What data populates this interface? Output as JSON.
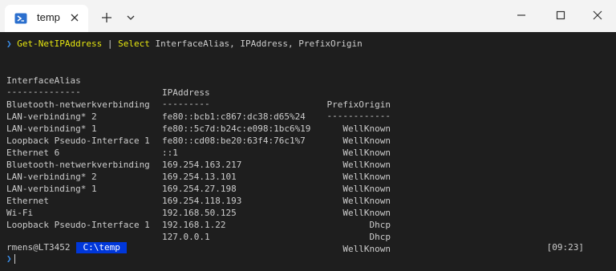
{
  "tab": {
    "title": "temp",
    "icon": "powershell-icon"
  },
  "window_controls": {
    "minimize": "minimize-icon",
    "maximize": "maximize-icon",
    "close": "close-icon"
  },
  "command": {
    "prompt_symbol": "❯",
    "cmdlet": "Get-NetIPAddress",
    "pipe": "|",
    "select": "Select",
    "args": "InterfaceAlias, IPAddress, PrefixOrigin"
  },
  "table": {
    "headers": [
      "InterfaceAlias",
      "IPAddress",
      "PrefixOrigin"
    ],
    "underlines": [
      "--------------",
      "---------",
      "------------"
    ],
    "rows": [
      [
        "Bluetooth-netwerkverbinding",
        "fe80::bcb1:c867:dc38:d65%24",
        "WellKnown"
      ],
      [
        "LAN-verbinding* 2",
        "fe80::5c7d:b24c:e098:1bc6%19",
        "WellKnown"
      ],
      [
        "LAN-verbinding* 1",
        "fe80::cd08:be20:63f4:76c1%7",
        "WellKnown"
      ],
      [
        "Loopback Pseudo-Interface 1",
        "::1",
        "WellKnown"
      ],
      [
        "Ethernet 6",
        "169.254.163.217",
        "WellKnown"
      ],
      [
        "Bluetooth-netwerkverbinding",
        "169.254.13.101",
        "WellKnown"
      ],
      [
        "LAN-verbinding* 2",
        "169.254.27.198",
        "WellKnown"
      ],
      [
        "LAN-verbinding* 1",
        "169.254.118.193",
        "WellKnown"
      ],
      [
        "Ethernet",
        "192.168.50.125",
        "Dhcp"
      ],
      [
        "Wi-Fi",
        "192.168.1.22",
        "Dhcp"
      ],
      [
        "Loopback Pseudo-Interface 1",
        "127.0.0.1",
        "WellKnown"
      ]
    ]
  },
  "status": {
    "user": "rmens@LT3452",
    "path": "C:\\temp",
    "time": "[09:23]"
  },
  "colors": {
    "background": "#1e1e1e",
    "accent": "#0037da",
    "command": "#e5e510",
    "prompt": "#3b8eea"
  }
}
